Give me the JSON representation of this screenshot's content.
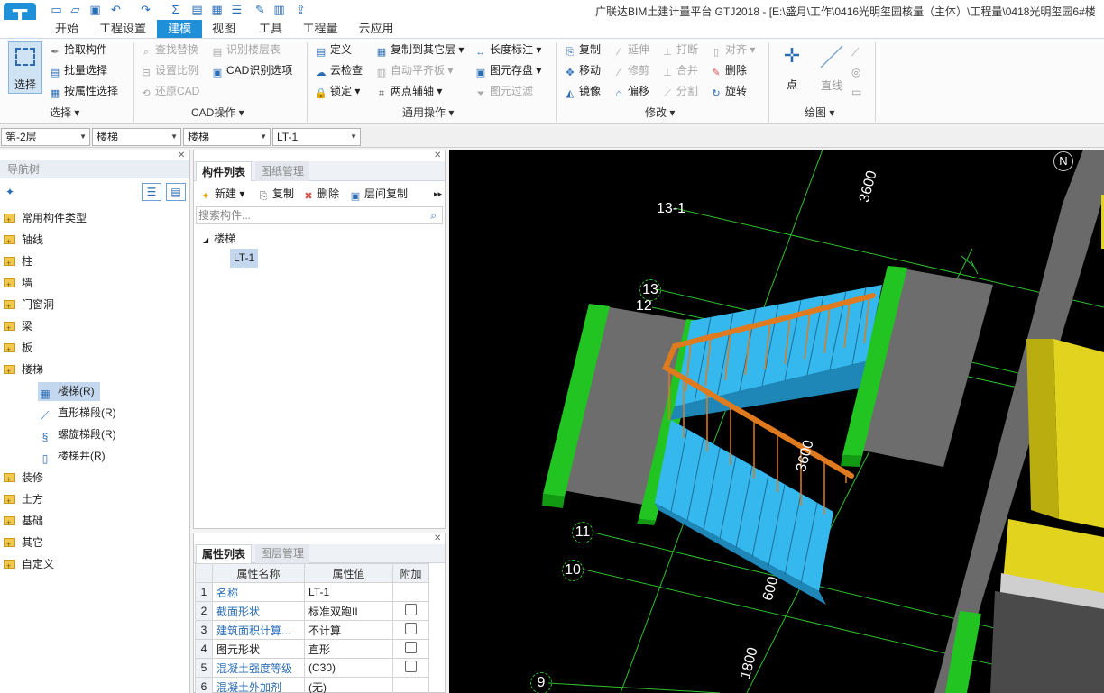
{
  "app_title": "广联达BIM土建计量平台 GTJ2018 - [E:\\盛月\\工作\\0416光明玺园核量（主体）\\工程量\\0418光明玺园6#楼",
  "logo_letter": "T",
  "tabs": [
    "开始",
    "工程设置",
    "建模",
    "视图",
    "工具",
    "工程量",
    "云应用"
  ],
  "ribbon": {
    "select": {
      "big_label": "选择",
      "items": [
        "拾取构件",
        "批量选择",
        "按属性选择"
      ],
      "group": "选择"
    },
    "cad": {
      "items": [
        "查找替换",
        "设置比例",
        "还原CAD",
        "识别楼层表",
        "CAD识别选项"
      ],
      "group": "CAD操作"
    },
    "common": {
      "items": [
        "定义",
        "云检查",
        "锁定",
        "复制到其它层",
        "自动平齐板",
        "两点辅轴",
        "长度标注",
        "图元存盘",
        "图元过滤"
      ],
      "group": "通用操作"
    },
    "modify": {
      "items": [
        "复制",
        "移动",
        "镜像",
        "延伸",
        "修剪",
        "偏移",
        "打断",
        "合并",
        "分割",
        "对齐",
        "删除",
        "旋转"
      ],
      "group": "修改"
    },
    "draw": {
      "items": [
        "点",
        "直线"
      ],
      "group": "绘图"
    }
  },
  "filters": [
    "第-2层",
    "楼梯",
    "楼梯",
    "LT-1"
  ],
  "nav": {
    "title": "导航树",
    "items": [
      "常用构件类型",
      "轴线",
      "柱",
      "墙",
      "门窗洞",
      "梁",
      "板",
      "楼梯",
      "装修",
      "土方",
      "基础",
      "其它",
      "自定义"
    ],
    "sub_items": [
      "楼梯(R)",
      "直形梯段(R)",
      "螺旋梯段(R)",
      "楼梯井(R)"
    ]
  },
  "components": {
    "tabs": [
      "构件列表",
      "图纸管理"
    ],
    "toolbar": [
      "新建",
      "复制",
      "删除",
      "层间复制"
    ],
    "search_placeholder": "搜索构件...",
    "tree_root": "楼梯",
    "tree_child": "LT-1"
  },
  "properties": {
    "tabs": [
      "属性列表",
      "图层管理"
    ],
    "headers": [
      "属性名称",
      "属性值",
      "附加"
    ],
    "rows": [
      {
        "n": "1",
        "name": "名称",
        "value": "LT-1",
        "check": false
      },
      {
        "n": "2",
        "name": "截面形状",
        "value": "标准双跑II",
        "check": true
      },
      {
        "n": "3",
        "name": "建筑面积计算...",
        "value": "不计算",
        "check": true
      },
      {
        "n": "4",
        "name": "图元形状",
        "value": "直形",
        "check": true
      },
      {
        "n": "5",
        "name": "混凝土强度等级",
        "value": "(C30)",
        "check": true
      },
      {
        "n": "6",
        "name": "混凝土外加剂",
        "value": "(无)",
        "check": false
      }
    ]
  },
  "viewport": {
    "axis_labels": [
      "13-1",
      "13",
      "12",
      "11",
      "10",
      "9"
    ],
    "dims": [
      "3600",
      "3600",
      "600",
      "1800"
    ],
    "compass": "N"
  }
}
